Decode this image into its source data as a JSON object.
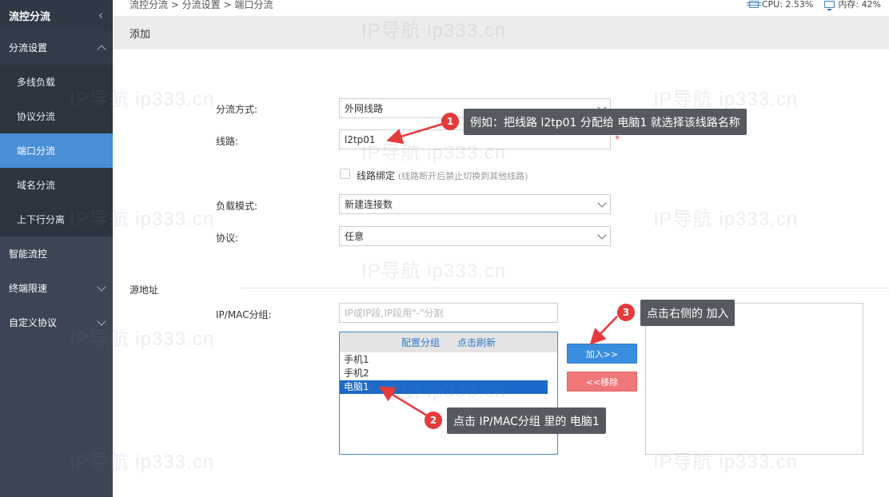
{
  "sidebar": {
    "title": "流控分流",
    "group_label": "分流设置",
    "sub_items": [
      {
        "label": "多线负载"
      },
      {
        "label": "协议分流"
      },
      {
        "label": "端口分流"
      },
      {
        "label": "域名分流"
      },
      {
        "label": "上下行分离"
      }
    ],
    "active_sub": "端口分流",
    "items": [
      {
        "label": "智能流控"
      },
      {
        "label": "终端限速"
      },
      {
        "label": "自定义协议"
      }
    ]
  },
  "topbar": {
    "breadcrumb": "流控分流 > 分流设置 > 端口分流",
    "cpu": "CPU: 2.53%",
    "mem": "内存: 42%"
  },
  "panel_title": "添加",
  "form": {
    "mode_label": "分流方式:",
    "mode_value": "外网线路",
    "line_label": "线路:",
    "line_value": "l2tp01",
    "required_mark": "*",
    "bind_label": "线路绑定",
    "bind_hint": "(线路断开后禁止切换到其他线路)",
    "load_label": "负载模式:",
    "load_value": "新建连接数",
    "proto_label": "协议:",
    "proto_value": "任意",
    "source_section": "源地址",
    "ipmac_label": "IP/MAC分组:",
    "ipmac_placeholder": "IP或IP段,IP段用\"-\"分割"
  },
  "group_box": {
    "config_link": "配置分组",
    "refresh_link": "点击刷新",
    "items": [
      {
        "label": "手机1",
        "selected": false
      },
      {
        "label": "手机2",
        "selected": false
      },
      {
        "label": "电脑1",
        "selected": true
      }
    ]
  },
  "buttons": {
    "add": "加入>>",
    "remove": "<<移除"
  },
  "annotations": [
    {
      "num": "1",
      "text": "例如：把线路 l2tp01 分配给 电脑1 就选择该线路名称"
    },
    {
      "num": "2",
      "text": "点击 IP/MAC分组 里的 电脑1"
    },
    {
      "num": "3",
      "text": "点击右侧的 加入"
    }
  ],
  "watermark": "IP导航  ip333.cn",
  "colors": {
    "sidebar_bg": "#3b4554",
    "active_item": "#4a8fd6",
    "add_button": "#3a8ee0",
    "remove_button": "#f07778",
    "badge": "#e53a3a",
    "callout_bg": "#555a60",
    "selected_row": "#1b69c9"
  }
}
